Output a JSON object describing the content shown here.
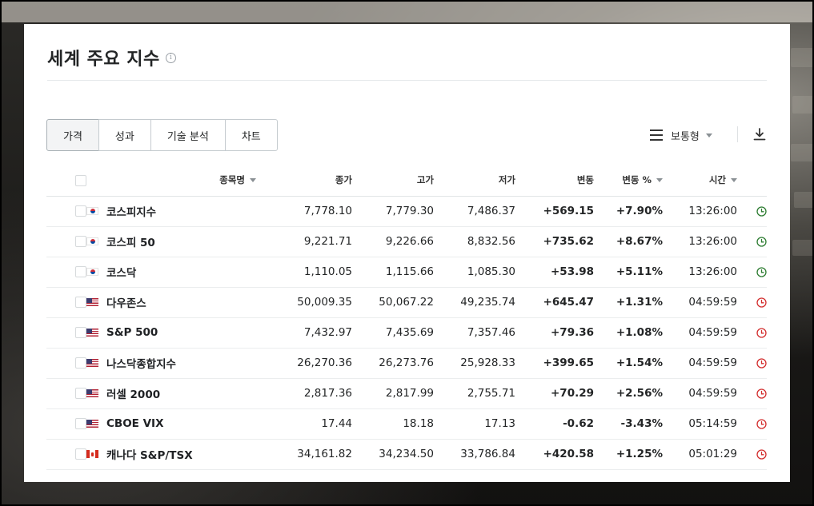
{
  "page": {
    "title": "세계 주요 지수",
    "info_icon": "info-icon"
  },
  "tabs": [
    {
      "label": "가격",
      "active": true
    },
    {
      "label": "성과",
      "active": false
    },
    {
      "label": "기술 분석",
      "active": false
    },
    {
      "label": "차트",
      "active": false
    }
  ],
  "view": {
    "label": "보통형",
    "menu_icon": "list-icon",
    "download_icon": "download-icon"
  },
  "table": {
    "headers": {
      "name": "종목명",
      "close": "종가",
      "high": "고가",
      "low": "저가",
      "change": "변동",
      "change_pct": "변동 %",
      "time": "시간"
    },
    "rows": [
      {
        "flag": "kr",
        "name": "코스피지수",
        "close": "7,778.10",
        "high": "7,779.30",
        "low": "7,486.37",
        "change": "+569.15",
        "change_pct": "+7.90%",
        "time": "13:26:00",
        "dir": "pos",
        "market": "open"
      },
      {
        "flag": "kr",
        "name": "코스피 50",
        "close": "9,221.71",
        "high": "9,226.66",
        "low": "8,832.56",
        "change": "+735.62",
        "change_pct": "+8.67%",
        "time": "13:26:00",
        "dir": "pos",
        "market": "open"
      },
      {
        "flag": "kr",
        "name": "코스닥",
        "close": "1,110.05",
        "high": "1,115.66",
        "low": "1,085.30",
        "change": "+53.98",
        "change_pct": "+5.11%",
        "time": "13:26:00",
        "dir": "pos",
        "market": "open"
      },
      {
        "flag": "us",
        "name": "다우존스",
        "close": "50,009.35",
        "high": "50,067.22",
        "low": "49,235.74",
        "change": "+645.47",
        "change_pct": "+1.31%",
        "time": "04:59:59",
        "dir": "pos",
        "market": "closed"
      },
      {
        "flag": "us",
        "name": "S&P 500",
        "close": "7,432.97",
        "high": "7,435.69",
        "low": "7,357.46",
        "change": "+79.36",
        "change_pct": "+1.08%",
        "time": "04:59:59",
        "dir": "pos",
        "market": "closed"
      },
      {
        "flag": "us",
        "name": "나스닥종합지수",
        "close": "26,270.36",
        "high": "26,273.76",
        "low": "25,928.33",
        "change": "+399.65",
        "change_pct": "+1.54%",
        "time": "04:59:59",
        "dir": "pos",
        "market": "closed"
      },
      {
        "flag": "us",
        "name": "러셀 2000",
        "close": "2,817.36",
        "high": "2,817.99",
        "low": "2,755.71",
        "change": "+70.29",
        "change_pct": "+2.56%",
        "time": "04:59:59",
        "dir": "pos",
        "market": "closed"
      },
      {
        "flag": "us",
        "name": "CBOE VIX",
        "close": "17.44",
        "high": "18.18",
        "low": "17.13",
        "change": "-0.62",
        "change_pct": "-3.43%",
        "time": "05:14:59",
        "dir": "neg",
        "market": "closed"
      },
      {
        "flag": "ca",
        "name": "캐나다 S&P/TSX",
        "close": "34,161.82",
        "high": "34,234.50",
        "low": "33,786.84",
        "change": "+420.58",
        "change_pct": "+1.25%",
        "time": "05:01:29",
        "dir": "pos",
        "market": "closed"
      }
    ]
  },
  "colors": {
    "positive": "#c62828",
    "negative": "#1565c0",
    "market_open": "#2e7d32",
    "market_closed": "#d32f2f"
  }
}
